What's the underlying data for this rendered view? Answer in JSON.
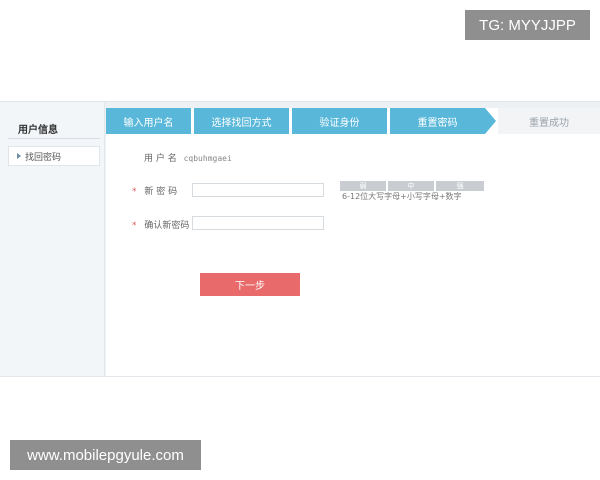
{
  "overlays": {
    "top_right": "TG: MYYJJPP",
    "bottom_left": "www.mobilepgyule.com"
  },
  "sidebar": {
    "title": "用户信息",
    "items": [
      {
        "label": "找回密码"
      }
    ]
  },
  "steps": [
    {
      "label": "输入用户名",
      "state": "done"
    },
    {
      "label": "选择找回方式",
      "state": "done"
    },
    {
      "label": "验证身份",
      "state": "done"
    },
    {
      "label": "重置密码",
      "state": "current"
    },
    {
      "label": "重置成功",
      "state": "pending"
    }
  ],
  "form": {
    "username_label": "用 户 名",
    "username_value": "cqbuhmgaei",
    "new_password_label": "新 密 码",
    "new_password_value": "",
    "confirm_label": "确认新密码",
    "confirm_value": "",
    "required_mark": "*",
    "strength_levels": [
      "弱",
      "中",
      "强"
    ],
    "hint": "6-12位大写字母+小写字母+数字"
  },
  "next_button": "下一步",
  "colors": {
    "step_active": "#59b8d9",
    "button": "#e96a6a",
    "required": "#e05a5a"
  }
}
